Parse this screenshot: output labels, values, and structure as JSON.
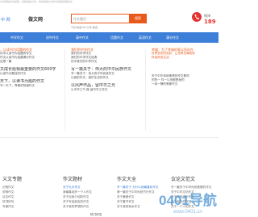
{
  "topbar": {
    "text": "分享网站作文投稿，投稿发给分享，单击投稿分享作文投稿投稿作文"
  },
  "header": {
    "logo_mark": "中 网",
    "logo_name": "做文网",
    "search": {
      "placeholder": "作文题目 -",
      "button_label": "搜索"
    },
    "hot_words": "干货 精选TOP 分享 精选",
    "phone_label": "微博",
    "phone_number": "189"
  },
  "nav": {
    "items": [
      "中学作文",
      "初中作文",
      "高中作文",
      "话题作文",
      "英语作文",
      "满分作文"
    ]
  },
  "panels": [
    {
      "head": "，以读书为话题的作文",
      "lines": [
        "初中以读书为话题的作文",
        "作文以读书为话题满分作文",
        "这是一篇",
        "文成长给我最重要的作文600字",
        "以读书为题目的作文",
        "天下，以读书为题的作文",
        "写一天下，青春的味道作文"
      ]
    },
    {
      "head": "我们的中学作文",
      "lines": [
        "我们的中学作文",
        "我们的中学作文经典",
        "初中我们的中学作文",
        "写一篇关于：伟大的中华民族作文",
        "写一篇关于：伟大的中华民族作文",
        "以我的作文，保护生态的作文",
        "以风声作品，留中华之光",
        "以中华之气 做 留中华之作文"
      ]
    },
    {
      "head": "幸福：为了幸福的意义而存在",
      "lines": [
        "世界多彩的色彩，让世界充满色彩",
        "科技改变生活",
        "关于中华传统美德的作文素材",
        "的的一 件一以来都是我的",
        "一幼一静的美景作文"
      ]
    }
  ],
  "footer": {
    "columns": [
      {
        "head": "义文专题",
        "lines": [
          "记叙作文",
          "说明作文",
          "议论作文",
          "好词好句",
          "写景作文"
        ]
      },
      {
        "head": "作文题材",
        "lines": [
          "关于礼仪作文",
          "我最喜欢的一个人作文",
          "关于自我介绍的作文",
          "关于写给朋友的作文",
          "关于我的梦想的作文"
        ]
      },
      {
        "head": "作文大全",
        "lines": [
          "写一篇关于 为什么我最喜欢作文",
          "第一篇关于中华传统节日作文",
          "关于暑假作文",
          "关于春节作文",
          "关于我的家乡作文"
        ]
      },
      {
        "head": "议论文范文",
        "lines": [
          "写一篇关于中华传统美德的作文",
          "关于中华文化作文",
          "关于我的成长作文",
          "关于秋天的作文",
          "关于一个人的作文"
        ]
      }
    ],
    "friend_label": "热门作文"
  },
  "watermark": {
    "brand": "0401导航",
    "sub": "www.0401.cn"
  },
  "colors": {
    "accent_blue": "#3d7fd8",
    "accent_orange": "#e8591a",
    "phone_red": "#e33333"
  }
}
